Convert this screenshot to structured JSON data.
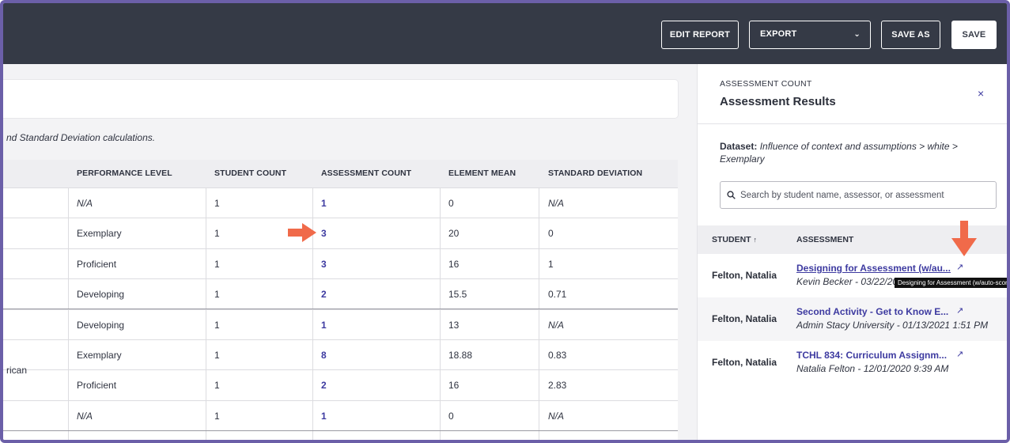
{
  "header": {
    "edit_report": "EDIT REPORT",
    "export": "EXPORT",
    "save_as": "SAVE AS",
    "save": "SAVE"
  },
  "main": {
    "note": "nd Standard Deviation calculations.",
    "columns": [
      "PERFORMANCE LEVEL",
      "STUDENT COUNT",
      "ASSESSMENT COUNT",
      "ELEMENT MEAN",
      "STANDARD DEVIATION"
    ],
    "group2_label": "rican",
    "rows": [
      {
        "level": "N/A",
        "students": "1",
        "assessments": "1",
        "mean": "0",
        "sd": "N/A"
      },
      {
        "level": "Exemplary",
        "students": "1",
        "assessments": "3",
        "mean": "20",
        "sd": "0"
      },
      {
        "level": "Proficient",
        "students": "1",
        "assessments": "3",
        "mean": "16",
        "sd": "1"
      },
      {
        "level": "Developing",
        "students": "1",
        "assessments": "2",
        "mean": "15.5",
        "sd": "0.71"
      },
      {
        "level": "Developing",
        "students": "1",
        "assessments": "1",
        "mean": "13",
        "sd": "N/A"
      },
      {
        "level": "Exemplary",
        "students": "1",
        "assessments": "8",
        "mean": "18.88",
        "sd": "0.83"
      },
      {
        "level": "Proficient",
        "students": "1",
        "assessments": "2",
        "mean": "16",
        "sd": "2.83"
      },
      {
        "level": "N/A",
        "students": "1",
        "assessments": "1",
        "mean": "0",
        "sd": "N/A"
      }
    ]
  },
  "panel": {
    "eyebrow": "ASSESSMENT COUNT",
    "title": "Assessment Results",
    "close": "×",
    "dataset_label": "Dataset:",
    "dataset_value": "Influence of context and assumptions > white > Exemplary",
    "search_placeholder": "Search by student name, assessor, or assessment",
    "col_student": "STUDENT",
    "col_sort": "↑",
    "col_assessment": "ASSESSMENT",
    "results": [
      {
        "student": "Felton, Natalia",
        "assessment": "Designing for Assessment (w/au...",
        "sub": "Kevin Becker - 03/22/2021 3:46 PM"
      },
      {
        "student": "Felton, Natalia",
        "assessment": "Second Activity - Get to Know E...",
        "sub": "Admin Stacy University - 01/13/2021 1:51 PM"
      },
      {
        "student": "Felton, Natalia",
        "assessment": "TCHL 834: Curriculum Assignm...",
        "sub": "Natalia Felton - 12/01/2020 9:39 AM"
      }
    ],
    "tooltip": "Designing for Assessment (w/auto-scoring)"
  },
  "colors": {
    "header_bg": "#353a46",
    "link": "#3d3aa0",
    "arrow": "#f06a4a",
    "frame": "#6b5fa8"
  },
  "icons": {
    "search": "search-icon",
    "external": "external-link-icon",
    "chevron": "chevron-down-icon",
    "close": "close-icon"
  }
}
